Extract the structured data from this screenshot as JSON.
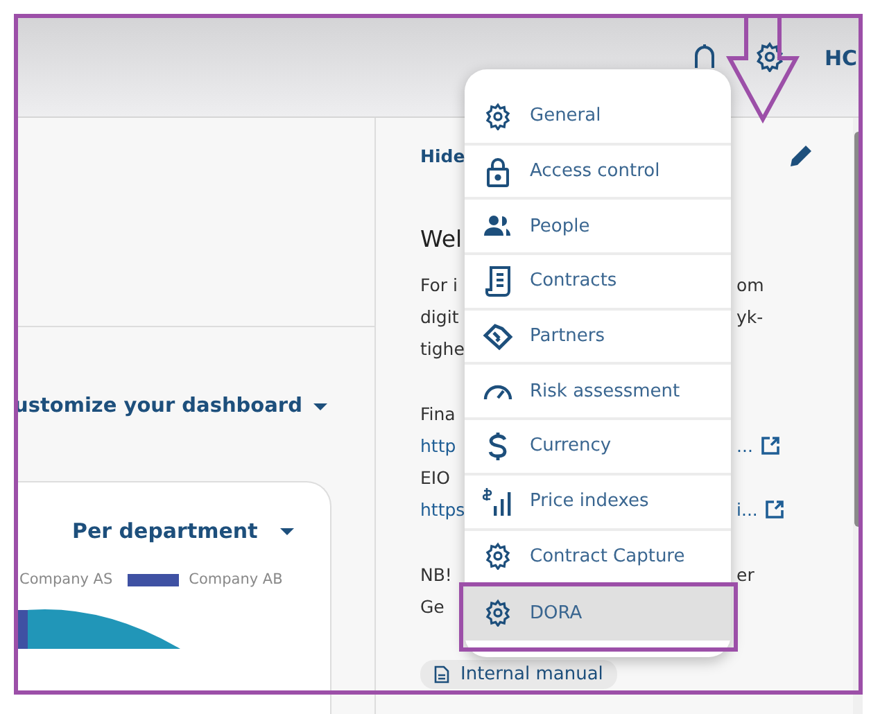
{
  "header": {
    "user_initials": "HC"
  },
  "left_panel": {
    "customize_label": "ustomize your dashboard",
    "card": {
      "title": "Per department",
      "legend": [
        {
          "label": "Company AS"
        },
        {
          "label": "Company AB",
          "color": "#3f51a3"
        }
      ]
    }
  },
  "right_panel": {
    "hide_label": "Hide",
    "heading": "Wel",
    "lines": [
      {
        "left": "For i",
        "right": "om",
        "kind": "text"
      },
      {
        "left": "digit",
        "right": "yk-",
        "kind": "text"
      },
      {
        "left": "tighe",
        "kind": "text"
      },
      {
        "kind": "gap"
      },
      {
        "left": "Fina",
        "kind": "text"
      },
      {
        "left": "http",
        "right": "...",
        "kind": "link"
      },
      {
        "left": "EIO",
        "kind": "text"
      },
      {
        "left": "https",
        "right": "i...",
        "kind": "link"
      },
      {
        "kind": "gap"
      },
      {
        "left": "NB!",
        "right": "er",
        "kind": "text"
      },
      {
        "left": "Ge",
        "kind": "text"
      }
    ],
    "chip": "Internal manual"
  },
  "settings_menu": {
    "items": [
      {
        "label": "General",
        "selected": false
      },
      {
        "label": "Access control",
        "selected": false
      },
      {
        "label": "People",
        "selected": false
      },
      {
        "label": "Contracts",
        "selected": false
      },
      {
        "label": "Partners",
        "selected": false
      },
      {
        "label": "Risk assessment",
        "selected": false
      },
      {
        "label": "Currency",
        "selected": false
      },
      {
        "label": "Price indexes",
        "selected": false
      },
      {
        "label": "Contract Capture",
        "selected": false
      },
      {
        "label": "DORA",
        "selected": true
      }
    ]
  },
  "annotations": [
    {
      "kind": "frame"
    },
    {
      "kind": "arrow"
    },
    {
      "kind": "highlight"
    }
  ]
}
